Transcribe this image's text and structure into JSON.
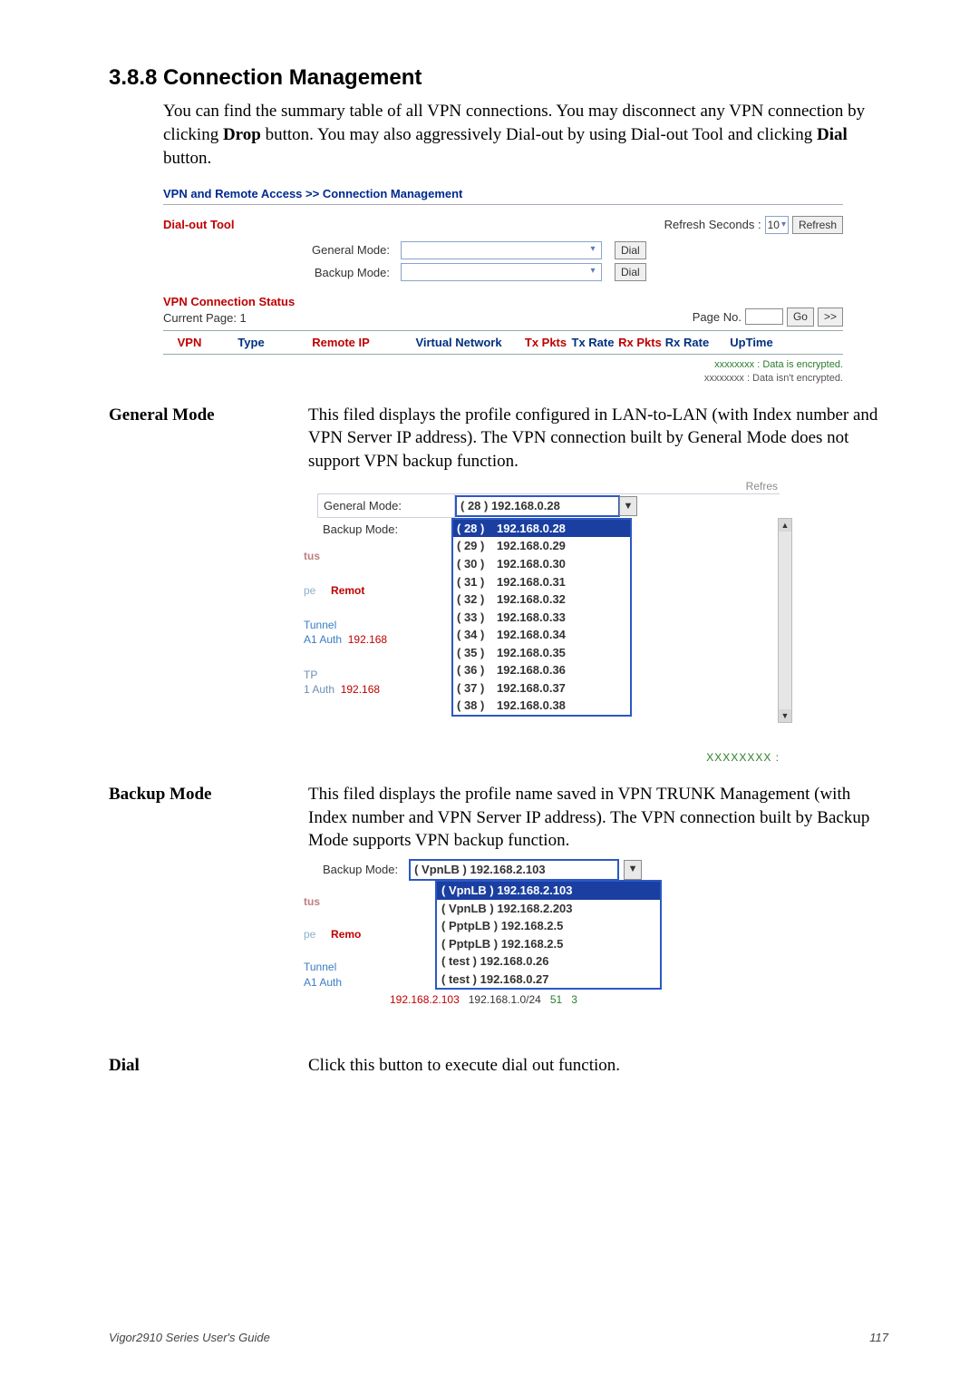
{
  "section": {
    "number_title": "3.8.8 Connection Management",
    "intro_1": "You can find the summary table of all VPN connections. You may disconnect any VPN connection by clicking ",
    "intro_bold1": "Drop",
    "intro_2": " button. You may also aggressively Dial-out by using Dial-out Tool and clicking ",
    "intro_bold2": "Dial",
    "intro_3": " button."
  },
  "panel": {
    "breadcrumb": "VPN and Remote Access >> Connection Management",
    "dialout_title": "Dial-out Tool",
    "refresh_label": "Refresh Seconds :",
    "refresh_value": "10",
    "refresh_btn": "Refresh",
    "general_mode_label": "General Mode:",
    "backup_mode_label": "Backup Mode:",
    "dial_btn": "Dial",
    "vcs_title": "VPN Connection Status",
    "current_page": "Current Page: 1",
    "page_no_label": "Page No.",
    "go_btn": "Go",
    "next_btn": ">>",
    "cols": {
      "vpn": "VPN",
      "type": "Type",
      "remote_ip": "Remote IP",
      "virtual_network": "Virtual Network",
      "tx_pkts": "Tx Pkts",
      "tx_rate": "Tx Rate",
      "rx_pkts": "Rx Pkts",
      "rx_rate": "Rx Rate",
      "uptime": "UpTime"
    },
    "legend_enc": "xxxxxxxx : Data is encrypted.",
    "legend_noenc": "xxxxxxxx : Data isn't encrypted."
  },
  "general_mode_section": {
    "term": "General Mode",
    "desc": "This filed displays the profile configured in LAN-to-LAN (with Index number and VPN Server IP address). The VPN connection built by General Mode does not support VPN backup function.",
    "topright": "Refres",
    "label_general": "General Mode:",
    "label_backup": "Backup Mode:",
    "selval": "( 28 ) 192.168.0.28",
    "options": [
      {
        "idx": "( 28 )",
        "ip": "192.168.0.28",
        "sel": true
      },
      {
        "idx": "( 29 )",
        "ip": "192.168.0.29"
      },
      {
        "idx": "( 30 )",
        "ip": "192.168.0.30"
      },
      {
        "idx": "( 31 )",
        "ip": "192.168.0.31"
      },
      {
        "idx": "( 32 )",
        "ip": "192.168.0.32"
      },
      {
        "idx": "( 33 )",
        "ip": "192.168.0.33"
      },
      {
        "idx": "( 34 )",
        "ip": "192.168.0.34"
      },
      {
        "idx": "( 35 )",
        "ip": "192.168.0.35"
      },
      {
        "idx": "( 36 )",
        "ip": "192.168.0.36"
      },
      {
        "idx": "( 37 )",
        "ip": "192.168.0.37"
      },
      {
        "idx": "( 38 )",
        "ip": "192.168.0.38"
      }
    ],
    "faded": {
      "tus": "tus",
      "pe": "pe",
      "remot": "Remot",
      "tunnel": "Tunnel",
      "a1auth": "A1 Auth",
      "ip1": "192.168",
      "tp": "TP",
      "a1auth2": "1 Auth",
      "ip2": "192.168"
    },
    "xxxx": "XXXXXXXX :"
  },
  "backup_mode_section": {
    "term": "Backup Mode",
    "desc": "This filed displays the profile name saved in VPN TRUNK Management (with Index number and VPN Server IP address). The VPN connection built by Backup Mode supports VPN backup function.",
    "label": "Backup Mode:",
    "selval": "( VpnLB ) 192.168.2.103",
    "options": [
      {
        "txt": "( VpnLB ) 192.168.2.103",
        "sel": true
      },
      {
        "txt": "( VpnLB ) 192.168.2.203"
      },
      {
        "txt": "( PptpLB ) 192.168.2.5"
      },
      {
        "txt": "( PptpLB ) 192.168.2.5"
      },
      {
        "txt": "( test ) 192.168.0.26"
      },
      {
        "txt": "( test ) 192.168.0.27"
      }
    ],
    "faded": {
      "tus": "tus",
      "pe": "pe",
      "remot": "Remo",
      "tunnel": "Tunnel",
      "a1auth": "A1 Auth"
    },
    "datarow": {
      "ip1": "192.168.2.103",
      "ip2": "192.168.1.0/24",
      "v1": "51",
      "v2": "3"
    }
  },
  "dial_section": {
    "term": "Dial",
    "desc": "Click this button to execute dial out function."
  },
  "footer": {
    "left": "Vigor2910 Series User's Guide",
    "right": "117"
  }
}
